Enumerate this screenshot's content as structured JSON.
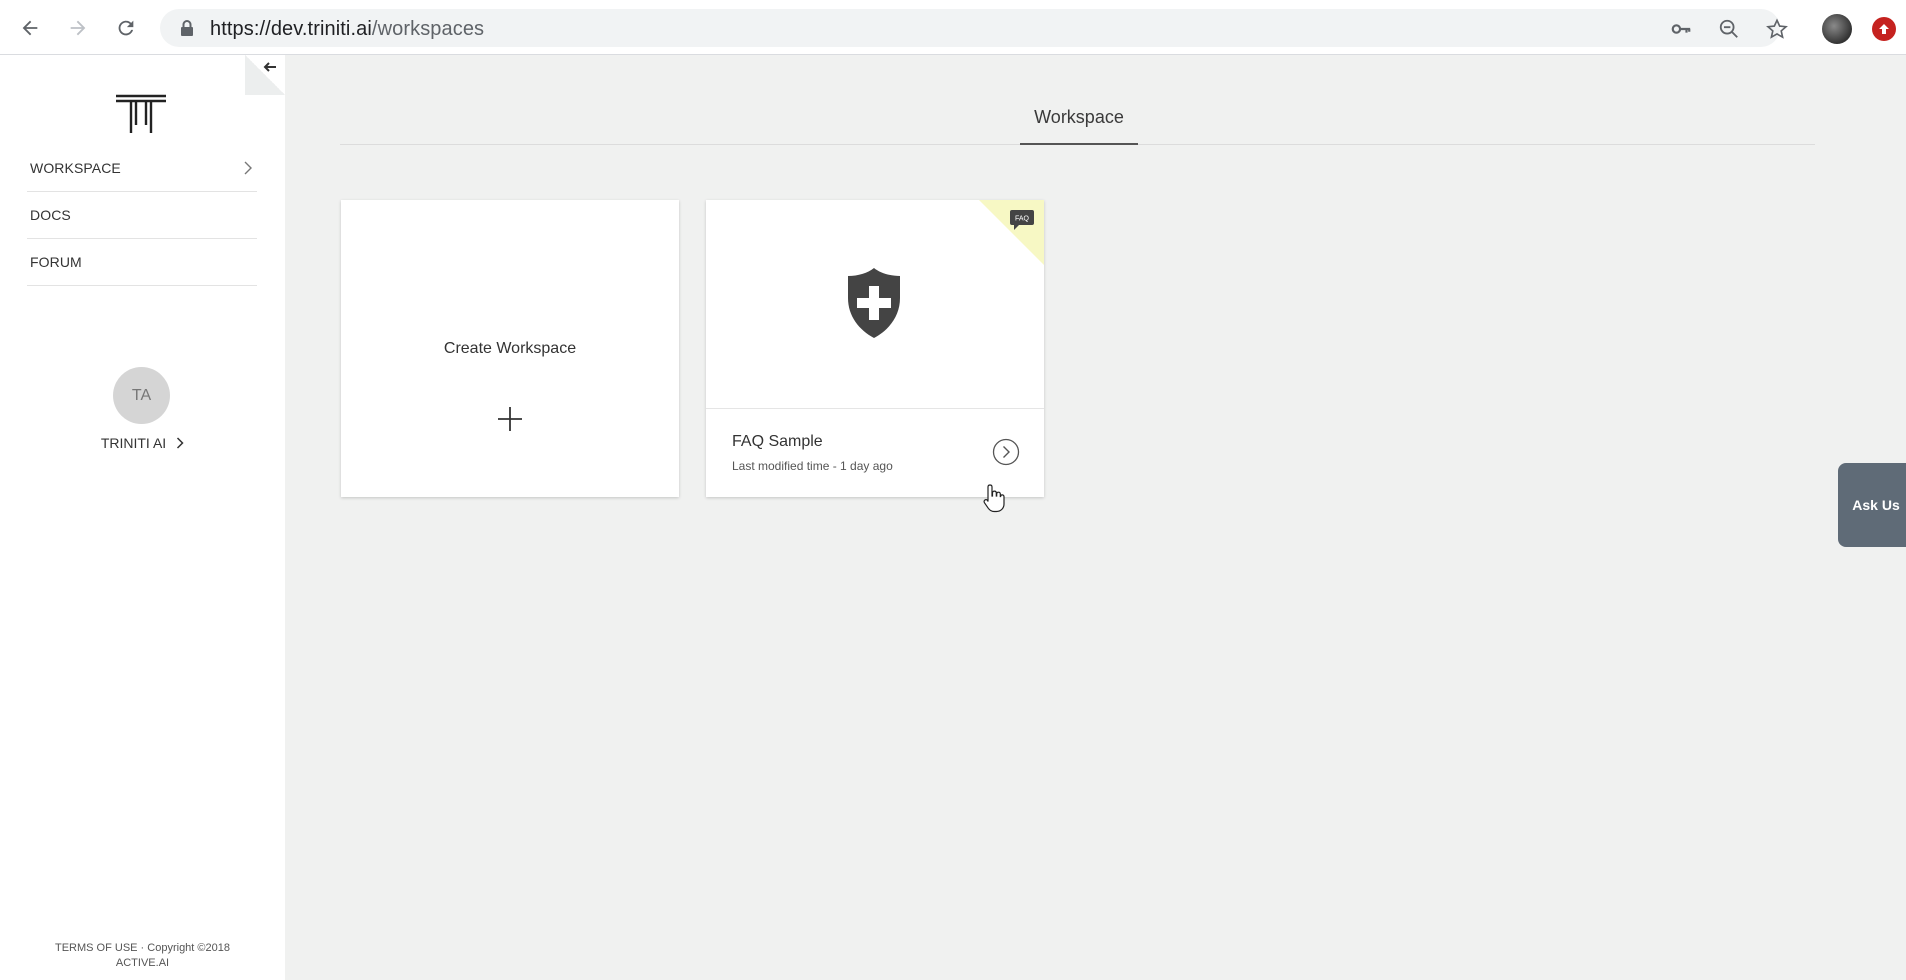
{
  "browser": {
    "url_host": "https://dev.triniti.ai",
    "url_path": "/workspaces"
  },
  "sidebar": {
    "items": [
      {
        "label": "WORKSPACE",
        "has_chevron": true
      },
      {
        "label": "DOCS"
      },
      {
        "label": "FORUM"
      }
    ],
    "user": {
      "initials": "TA",
      "name": "TRINITI AI"
    },
    "footer": "TERMS OF USE · Copyright ©2018 ACTIVE.AI"
  },
  "main": {
    "tab": "Workspace",
    "create_card": {
      "title": "Create Workspace"
    },
    "workspace_card": {
      "badge": "FAQ",
      "name": "FAQ Sample",
      "modified": "Last modified time - 1 day ago"
    }
  },
  "ask_us": "Ask Us",
  "colors": {
    "main_bg": "#f0f1f0",
    "corner_badge": "#f7f8c4",
    "ask_us_bg": "#5f6b77",
    "icon_dark": "#444444"
  }
}
